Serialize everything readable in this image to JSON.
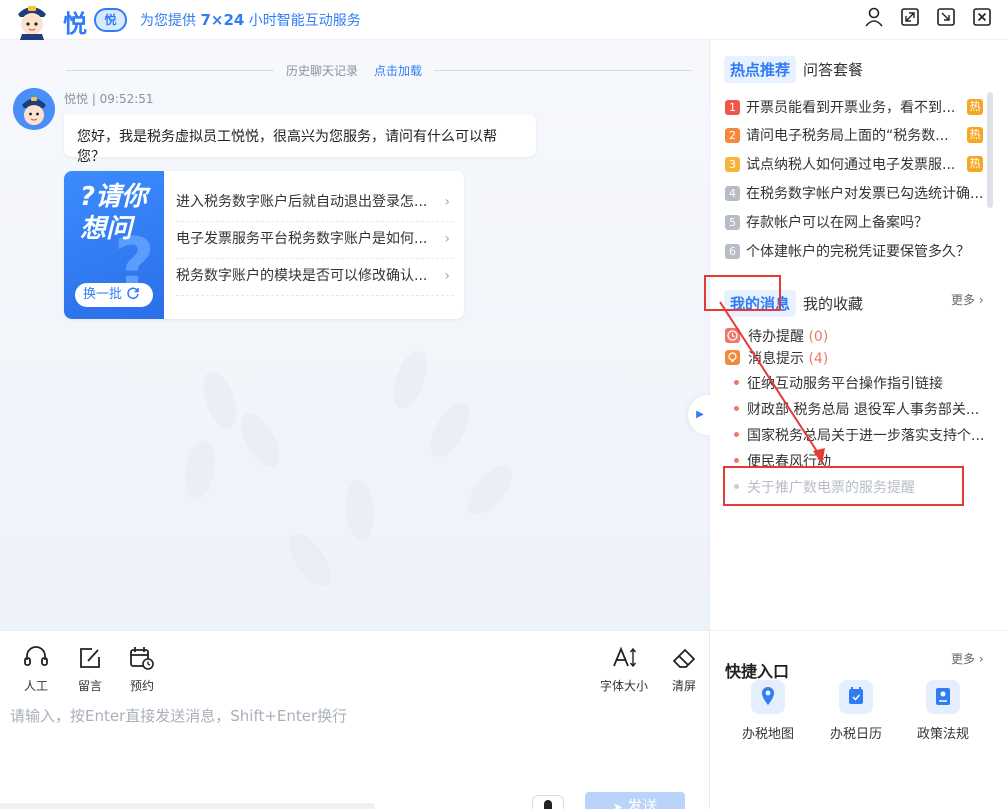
{
  "header": {
    "logo_text": "悦",
    "logo_badge": "悦",
    "slogan_prefix": "为您提供",
    "slogan_strong": "7×24",
    "slogan_suffix": "小时智能互动服务",
    "icons": [
      "user-icon",
      "fullscreen-icon",
      "exit-icon",
      "close-icon"
    ]
  },
  "chat": {
    "history_label": "历史聊天记录",
    "history_load": "点击加载",
    "bot_meta": "悦悦 | 09:52:51",
    "greeting": "您好，我是税务虚拟员工悦悦，很高兴为您服务，请问有什么可以帮您？",
    "ask_title_line1": "?请你",
    "ask_title_line2": "想问",
    "swap_label": "换一批",
    "ask_items": [
      "进入税务数字账户后就自动退出登录怎...",
      "电子发票服务平台税务数字账户是如何...",
      "税务数字账户的模块是否可以修改确认..."
    ]
  },
  "toolbar": {
    "human_label": "人工",
    "message_label": "留言",
    "booking_label": "预约",
    "font_size_label": "字体大小",
    "clear_label": "清屏"
  },
  "input": {
    "placeholder": "请输入，按Enter直接发送消息，Shift+Enter换行",
    "send_label": "发送"
  },
  "sidebar": {
    "tabs_top": [
      "热点推荐",
      "问答套餐"
    ],
    "hot_items": [
      {
        "num": "1",
        "color": "#f0564a",
        "text": "开票员能看到开票业务，看不到...",
        "hot": true
      },
      {
        "num": "2",
        "color": "#f5893a",
        "text": "请问电子税务局上面的“税务数...",
        "hot": true
      },
      {
        "num": "3",
        "color": "#f5b53a",
        "text": "试点纳税人如何通过电子发票服...",
        "hot": true
      },
      {
        "num": "4",
        "color": "#b7bdc7",
        "text": "在税务数字帐户对发票已勾选统计确...",
        "hot": false
      },
      {
        "num": "5",
        "color": "#b7bdc7",
        "text": "存款帐户可以在网上备案吗？",
        "hot": false
      },
      {
        "num": "6",
        "color": "#b7bdc7",
        "text": "个体建帐户的完税凭证要保管多久？",
        "hot": false
      }
    ],
    "hot_tag": "热",
    "tabs_mid": [
      "我的消息",
      "我的收藏"
    ],
    "more_label": "更多",
    "todo_label": "待办提醒",
    "todo_count": "(0)",
    "notice_label": "消息提示",
    "notice_count": "(4)",
    "messages": [
      {
        "text": "征纳互动服务平台操作指引链接",
        "read": false
      },
      {
        "text": "财政部 税务总局 退役军人事务部关...",
        "read": false
      },
      {
        "text": "国家税务总局关于进一步落实支持个...",
        "read": false
      },
      {
        "text": "便民春风行动",
        "read": false
      },
      {
        "text": "关于推广数电票的服务提醒",
        "read": true
      }
    ],
    "quick_title": "快捷入口",
    "quick_more": "更多",
    "quick_items": [
      "办税地图",
      "办税日历",
      "政策法规"
    ]
  },
  "colors": {
    "accent": "#2f7df6",
    "highlight_red": "#e53935",
    "count_red": "#f0776a"
  }
}
